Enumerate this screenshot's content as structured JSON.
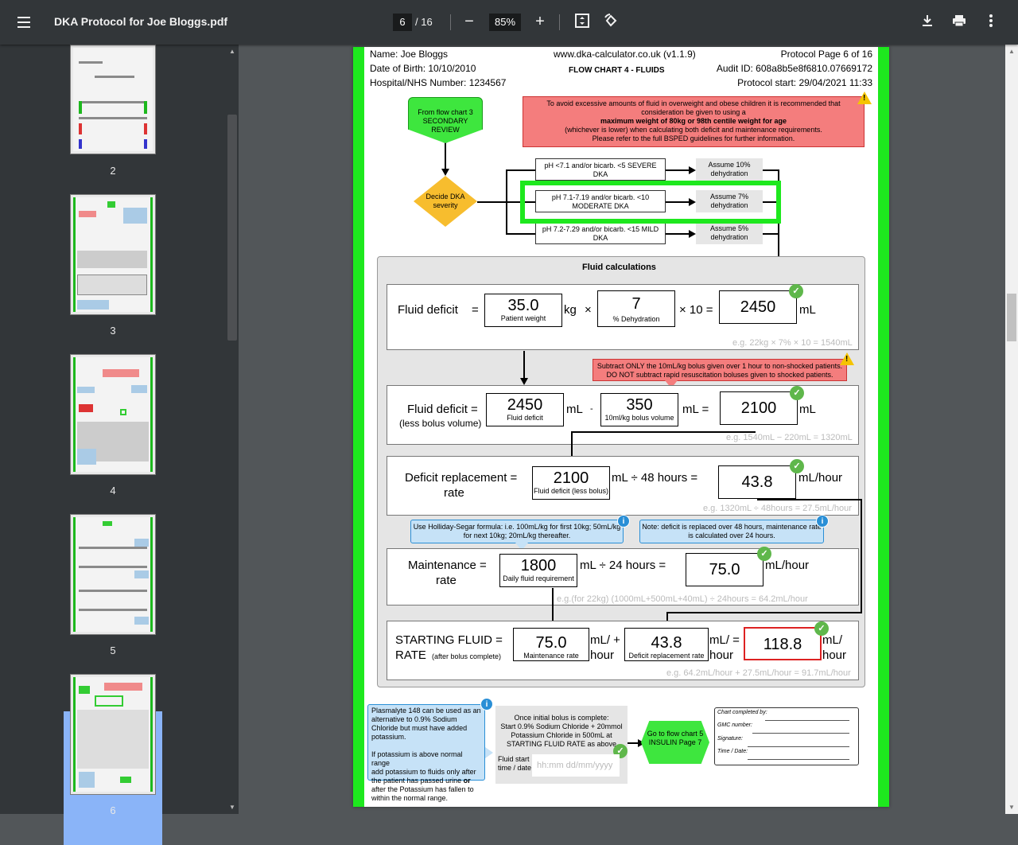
{
  "toolbar": {
    "filename": "DKA Protocol for Joe Bloggs.pdf",
    "current_page": "6",
    "total_pages": "/ 16",
    "zoom": "85%"
  },
  "thumbnails": [
    {
      "label": "2"
    },
    {
      "label": "3"
    },
    {
      "label": "4"
    },
    {
      "label": "5"
    },
    {
      "label": "6"
    }
  ],
  "header": {
    "name": "Name: Joe Bloggs",
    "dob": "Date of Birth: 10/10/2010",
    "nhs": "Hospital/NHS Number: 1234567",
    "site": "www.dka-calculator.co.uk (v1.1.9)",
    "chart_title": "FLOW CHART 4 - FLUIDS",
    "protocol_page": "Protocol Page 6 of 16",
    "audit": "Audit ID: 608a8b5e8f6810.07669172",
    "start": "Protocol start: 29/04/2021 11:33"
  },
  "flow": {
    "from_chart": "From flow chart 3 SECONDARY REVIEW",
    "decide": "Decide DKA severity",
    "warning_lines": [
      "To avoid excessive amounts of fluid in overweight and obese children it is recommended that",
      "consideration be given to using a",
      "maximum weight of 80kg or 98th centile weight for age",
      "(whichever is lower) when calculating both deficit and maintenance requirements.",
      "Please refer to the full BSPED guidelines for further information."
    ],
    "severe": "pH <7.1 and/or bicarb. <5 SEVERE DKA",
    "moderate": "pH 7.1-7.19 and/or bicarb. <10 MODERATE DKA",
    "mild": "pH 7.2-7.29 and/or bicarb. <15 MILD DKA",
    "assume10": "Assume 10% dehydration",
    "assume7": "Assume 7% dehydration",
    "assume5": "Assume 5% dehydration"
  },
  "calc": {
    "heading": "Fluid calculations",
    "fd_label": "Fluid deficit",
    "weight": "35.0",
    "weight_cap": "Patient weight",
    "kg": "kg",
    "times": "×",
    "pct": "7",
    "pct_cap": "% Dehydration",
    "times10": "× 10 =",
    "deficit": "2450",
    "ml": "mL",
    "eg1": "e.g. 22kg × 7% × 10 = 1540mL",
    "bolus_warning": "Subtract ONLY the 10mL/kg bolus given over 1 hour to non-shocked patients. DO NOT subtract rapid resuscitation boluses given to shocked patients.",
    "fdb_label": "Fluid deficit =",
    "fdb_sub": "(less bolus volume)",
    "fd2": "2450",
    "fd2_cap": "Fluid deficit",
    "minus": "-",
    "bolus": "350",
    "bolus_cap": "10ml/kg bolus volume",
    "ml_eq": "mL =",
    "fdless": "2100",
    "eg2": "e.g. 1540mL − 220mL = 1320mL",
    "drr_label": "Deficit replacement =",
    "drr_sub": "rate",
    "drr_in": "2100",
    "drr_in_cap": "Fluid deficit (less bolus)",
    "div48": "mL ÷ 48 hours =",
    "drr": "43.8",
    "mlhr": "mL/hour",
    "eg3": "e.g. 1320mL ÷ 48hours = 27.5mL/hour",
    "hs_info": "Use Holliday-Segar formula: i.e. 100mL/kg for first 10kg; 50mL/kg for next 10kg; 20mL/kg thereafter.",
    "note_info": "Note: deficit is replaced over 48 hours, maintenance rate is calculated over 24 hours.",
    "mr_label": "Maintenance =",
    "mr_sub": "rate",
    "daily": "1800",
    "daily_cap": "Daily fluid requirement",
    "div24": "mL ÷ 24 hours =",
    "mr": "75.0",
    "eg4": "e.g.(for 22kg) (1000mL+500mL+40mL) ÷ 24hours = 64.2mL/hour",
    "sfr_label": "STARTING FLUID =",
    "sfr_rate": "RATE",
    "sfr_sub": "(after bolus complete)",
    "sfr_m": "75.0",
    "sfr_m_cap": "Maintenance rate",
    "mlplus": "mL/ +",
    "hour": "hour",
    "sfr_d": "43.8",
    "sfr_d_cap": "Deficit replacement rate",
    "mleq": "mL/ =",
    "sfr": "118.8",
    "ml_slash": "mL/",
    "eg5": "e.g. 64.2mL/hour + 27.5mL/hour = 91.7mL/hour"
  },
  "bottom": {
    "plasmalyte": "Plasmalyte 148 can be used as an alternative to 0.9% Sodium Chloride but must have added potassium.",
    "potassium_lines": [
      "If potassium is above normal range",
      "add potassium to fluids only after",
      "the patient has passed urine",
      "or",
      "after the Potassium has fallen to",
      "within the normal range."
    ],
    "start_lines": [
      "Once initial bolus is complete:",
      "Start 0.9% Sodium Chloride + 20mmol",
      "Potassium Chloride in 500mL at",
      "STARTING FLUID RATE as above"
    ],
    "fluid_start": "Fluid start time / date",
    "time_placeholder": "hh:mm dd/mm/yyyy",
    "goto": "Go to flow chart 5 INSULIN Page 7",
    "completed_by": "Chart completed by:",
    "gmc": "GMC number:",
    "signature": "Signature:",
    "timedate": "Time / Date:"
  },
  "colors": {
    "accent_green": "#1ee81e",
    "warning_red": "#f47d7d",
    "info_blue": "#c6e2f7",
    "flow_green": "#3ee63e",
    "decide_amber": "#f7bd2e"
  }
}
